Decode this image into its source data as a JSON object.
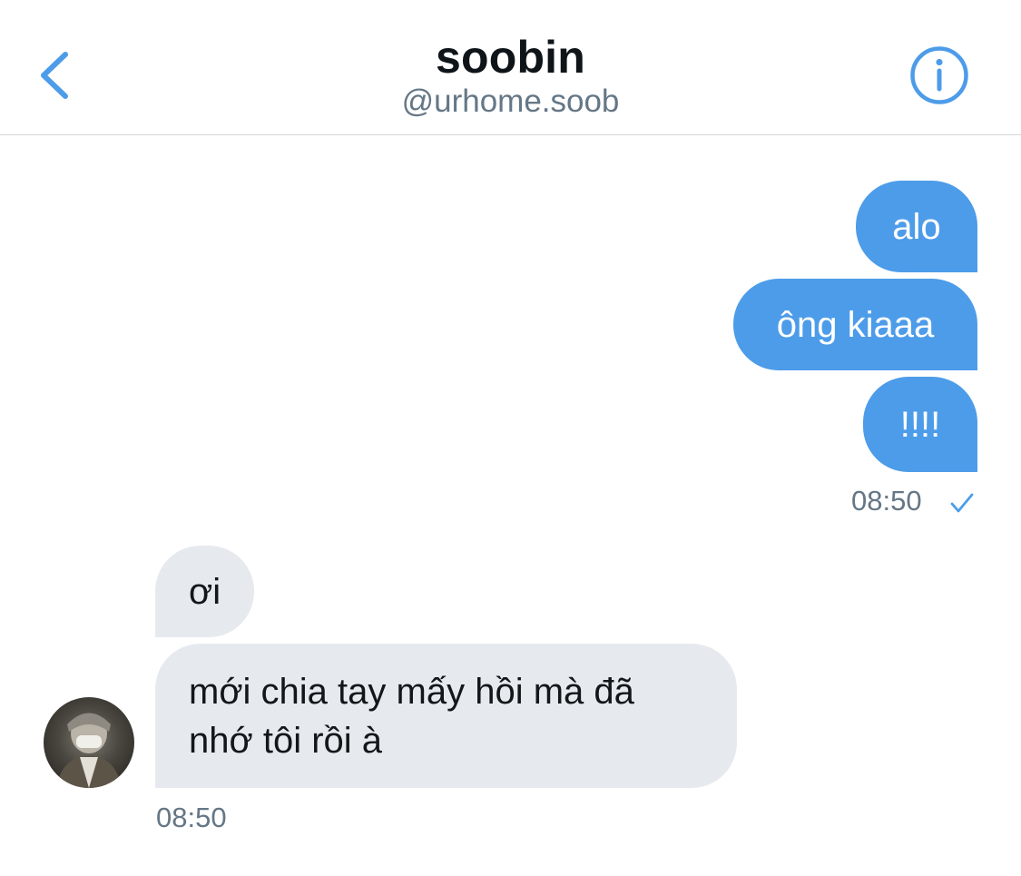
{
  "header": {
    "name": "soobin",
    "handle": "@urhome.soob",
    "back_icon": "chevron-left-icon",
    "info_icon": "info-icon",
    "accent_color": "#4d9ce9"
  },
  "messages": {
    "sent": [
      {
        "text": "alo"
      },
      {
        "text": "ông kiaaa"
      },
      {
        "text": "!!!!"
      }
    ],
    "sent_time": "08:50",
    "sent_status_icon": "checkmark-icon",
    "received": [
      {
        "text": "ơi"
      },
      {
        "text": "mới chia tay mấy hồi mà đã nhớ tôi rồi à"
      }
    ],
    "received_time": "08:50",
    "sent_bubble_color": "#4d9ce9",
    "received_bubble_color": "#e6eaef"
  }
}
